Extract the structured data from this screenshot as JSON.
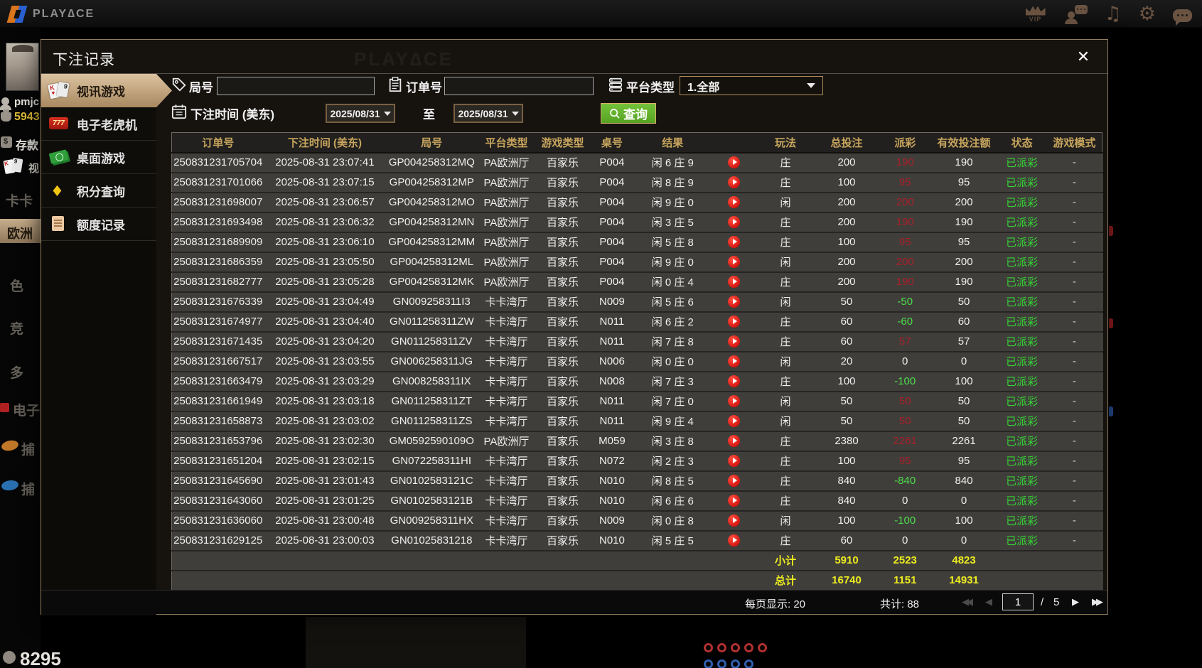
{
  "topbar": {
    "brand": "PLAY∆CE",
    "vip_label": "VIP",
    "music_glyph": "♫",
    "gear_glyph": "⚙"
  },
  "lobby": {
    "username": "pmjc",
    "balance": "5943",
    "deposit_label": "存款",
    "video_label": "视",
    "menu": [
      "卡卡",
      "欧洲",
      "色",
      "竞",
      "多",
      "电子",
      "捕",
      "捕"
    ],
    "bottom_number": "8295"
  },
  "modal": {
    "title": "下注记录",
    "close_glyph": "✕",
    "watermark": "PLAY∆CE",
    "tabs": [
      {
        "label": "视讯游戏",
        "active": true
      },
      {
        "label": "电子老虎机",
        "active": false
      },
      {
        "label": "桌面游戏",
        "active": false
      },
      {
        "label": "积分查询",
        "active": false
      },
      {
        "label": "额度记录",
        "active": false
      }
    ],
    "filters": {
      "round_label": "局号",
      "round_value": "",
      "order_label": "订单号",
      "order_value": "",
      "platform_label": "平台类型",
      "platform_value": "1.全部",
      "time_label": "下注时间 (美东)",
      "date_from": "2025/08/31",
      "to_label": "至",
      "date_to": "2025/08/31",
      "search_label": "查询"
    },
    "table": {
      "headers": [
        "订单号",
        "下注时间 (美东)",
        "局号",
        "平台类型",
        "游戏类型",
        "桌号",
        "结果",
        "",
        "玩法",
        "总投注",
        "派彩",
        "有效投注额",
        "状态",
        "游戏模式"
      ],
      "rows": [
        {
          "order": "250831231705704",
          "time": "2025-08-31 23:07:41",
          "round": "GP004258312MQ",
          "platform": "PA欧洲厅",
          "game": "百家乐",
          "table": "P004",
          "result": "闲 6 庄 9",
          "bet_on": "庄",
          "total_bet": "200",
          "payout": "190",
          "payout_class": "pos",
          "valid_bet": "190",
          "status": "已派彩",
          "mode": "-"
        },
        {
          "order": "250831231701066",
          "time": "2025-08-31 23:07:15",
          "round": "GP004258312MP",
          "platform": "PA欧洲厅",
          "game": "百家乐",
          "table": "P004",
          "result": "闲 8 庄 9",
          "bet_on": "庄",
          "total_bet": "100",
          "payout": "95",
          "payout_class": "pos",
          "valid_bet": "95",
          "status": "已派彩",
          "mode": "-"
        },
        {
          "order": "250831231698007",
          "time": "2025-08-31 23:06:57",
          "round": "GP004258312MO",
          "platform": "PA欧洲厅",
          "game": "百家乐",
          "table": "P004",
          "result": "闲 9 庄 0",
          "bet_on": "闲",
          "total_bet": "200",
          "payout": "200",
          "payout_class": "pos",
          "valid_bet": "200",
          "status": "已派彩",
          "mode": "-"
        },
        {
          "order": "250831231693498",
          "time": "2025-08-31 23:06:32",
          "round": "GP004258312MN",
          "platform": "PA欧洲厅",
          "game": "百家乐",
          "table": "P004",
          "result": "闲 3 庄 5",
          "bet_on": "庄",
          "total_bet": "200",
          "payout": "190",
          "payout_class": "pos",
          "valid_bet": "190",
          "status": "已派彩",
          "mode": "-"
        },
        {
          "order": "250831231689909",
          "time": "2025-08-31 23:06:10",
          "round": "GP004258312MM",
          "platform": "PA欧洲厅",
          "game": "百家乐",
          "table": "P004",
          "result": "闲 5 庄 8",
          "bet_on": "庄",
          "total_bet": "100",
          "payout": "95",
          "payout_class": "pos",
          "valid_bet": "95",
          "status": "已派彩",
          "mode": "-"
        },
        {
          "order": "250831231686359",
          "time": "2025-08-31 23:05:50",
          "round": "GP004258312ML",
          "platform": "PA欧洲厅",
          "game": "百家乐",
          "table": "P004",
          "result": "闲 9 庄 0",
          "bet_on": "闲",
          "total_bet": "200",
          "payout": "200",
          "payout_class": "pos",
          "valid_bet": "200",
          "status": "已派彩",
          "mode": "-"
        },
        {
          "order": "250831231682777",
          "time": "2025-08-31 23:05:28",
          "round": "GP004258312MK",
          "platform": "PA欧洲厅",
          "game": "百家乐",
          "table": "P004",
          "result": "闲 0 庄 4",
          "bet_on": "庄",
          "total_bet": "200",
          "payout": "190",
          "payout_class": "pos",
          "valid_bet": "190",
          "status": "已派彩",
          "mode": "-"
        },
        {
          "order": "250831231676339",
          "time": "2025-08-31 23:04:49",
          "round": "GN009258311I3",
          "platform": "卡卡湾厅",
          "game": "百家乐",
          "table": "N009",
          "result": "闲 5 庄 6",
          "bet_on": "闲",
          "total_bet": "50",
          "payout": "-50",
          "payout_class": "neg",
          "valid_bet": "50",
          "status": "已派彩",
          "mode": "-"
        },
        {
          "order": "250831231674977",
          "time": "2025-08-31 23:04:40",
          "round": "GN011258311ZW",
          "platform": "卡卡湾厅",
          "game": "百家乐",
          "table": "N011",
          "result": "闲 6 庄 2",
          "bet_on": "庄",
          "total_bet": "60",
          "payout": "-60",
          "payout_class": "neg",
          "valid_bet": "60",
          "status": "已派彩",
          "mode": "-"
        },
        {
          "order": "250831231671435",
          "time": "2025-08-31 23:04:20",
          "round": "GN011258311ZV",
          "platform": "卡卡湾厅",
          "game": "百家乐",
          "table": "N011",
          "result": "闲 7 庄 8",
          "bet_on": "庄",
          "total_bet": "60",
          "payout": "57",
          "payout_class": "pos",
          "valid_bet": "57",
          "status": "已派彩",
          "mode": "-"
        },
        {
          "order": "250831231667517",
          "time": "2025-08-31 23:03:55",
          "round": "GN006258311JG",
          "platform": "卡卡湾厅",
          "game": "百家乐",
          "table": "N006",
          "result": "闲 0 庄 0",
          "bet_on": "闲",
          "total_bet": "20",
          "payout": "0",
          "payout_class": "zero",
          "valid_bet": "0",
          "status": "已派彩",
          "mode": "-"
        },
        {
          "order": "250831231663479",
          "time": "2025-08-31 23:03:29",
          "round": "GN008258311IX",
          "platform": "卡卡湾厅",
          "game": "百家乐",
          "table": "N008",
          "result": "闲 7 庄 3",
          "bet_on": "庄",
          "total_bet": "100",
          "payout": "-100",
          "payout_class": "neg",
          "valid_bet": "100",
          "status": "已派彩",
          "mode": "-"
        },
        {
          "order": "250831231661949",
          "time": "2025-08-31 23:03:18",
          "round": "GN011258311ZT",
          "platform": "卡卡湾厅",
          "game": "百家乐",
          "table": "N011",
          "result": "闲 7 庄 0",
          "bet_on": "闲",
          "total_bet": "50",
          "payout": "50",
          "payout_class": "pos",
          "valid_bet": "50",
          "status": "已派彩",
          "mode": "-"
        },
        {
          "order": "250831231658873",
          "time": "2025-08-31 23:03:02",
          "round": "GN011258311ZS",
          "platform": "卡卡湾厅",
          "game": "百家乐",
          "table": "N011",
          "result": "闲 9 庄 4",
          "bet_on": "闲",
          "total_bet": "50",
          "payout": "50",
          "payout_class": "pos",
          "valid_bet": "50",
          "status": "已派彩",
          "mode": "-"
        },
        {
          "order": "250831231653796",
          "time": "2025-08-31 23:02:30",
          "round": "GM0592590109O",
          "platform": "PA欧洲厅",
          "game": "百家乐",
          "table": "M059",
          "result": "闲 3 庄 8",
          "bet_on": "庄",
          "total_bet": "2380",
          "payout": "2261",
          "payout_class": "pos",
          "valid_bet": "2261",
          "status": "已派彩",
          "mode": "-"
        },
        {
          "order": "250831231651204",
          "time": "2025-08-31 23:02:15",
          "round": "GN072258311HI",
          "platform": "卡卡湾厅",
          "game": "百家乐",
          "table": "N072",
          "result": "闲 2 庄 3",
          "bet_on": "庄",
          "total_bet": "100",
          "payout": "95",
          "payout_class": "pos",
          "valid_bet": "95",
          "status": "已派彩",
          "mode": "-"
        },
        {
          "order": "250831231645690",
          "time": "2025-08-31 23:01:43",
          "round": "GN0102583121C",
          "platform": "卡卡湾厅",
          "game": "百家乐",
          "table": "N010",
          "result": "闲 8 庄 5",
          "bet_on": "庄",
          "total_bet": "840",
          "payout": "-840",
          "payout_class": "neg",
          "valid_bet": "840",
          "status": "已派彩",
          "mode": "-"
        },
        {
          "order": "250831231643060",
          "time": "2025-08-31 23:01:25",
          "round": "GN0102583121B",
          "platform": "卡卡湾厅",
          "game": "百家乐",
          "table": "N010",
          "result": "闲 6 庄 6",
          "bet_on": "庄",
          "total_bet": "840",
          "payout": "0",
          "payout_class": "zero",
          "valid_bet": "0",
          "status": "已派彩",
          "mode": "-"
        },
        {
          "order": "250831231636060",
          "time": "2025-08-31 23:00:48",
          "round": "GN009258311HX",
          "platform": "卡卡湾厅",
          "game": "百家乐",
          "table": "N009",
          "result": "闲 0 庄 8",
          "bet_on": "闲",
          "total_bet": "100",
          "payout": "-100",
          "payout_class": "neg",
          "valid_bet": "100",
          "status": "已派彩",
          "mode": "-"
        },
        {
          "order": "250831231629125",
          "time": "2025-08-31 23:00:03",
          "round": "GN01025831218",
          "platform": "卡卡湾厅",
          "game": "百家乐",
          "table": "N010",
          "result": "闲 5 庄 5",
          "bet_on": "庄",
          "total_bet": "60",
          "payout": "0",
          "payout_class": "zero",
          "valid_bet": "0",
          "status": "已派彩",
          "mode": "-"
        }
      ],
      "subtotal": {
        "label": "小计",
        "total_bet": "5910",
        "payout": "2523",
        "valid_bet": "4823"
      },
      "grand_total": {
        "label": "总计",
        "total_bet": "16740",
        "payout": "1151",
        "valid_bet": "14931"
      }
    },
    "pagination": {
      "per_page": "每页显示: 20",
      "total_count": "共计: 88",
      "page": "1",
      "separator": "/",
      "pages": "5"
    }
  }
}
